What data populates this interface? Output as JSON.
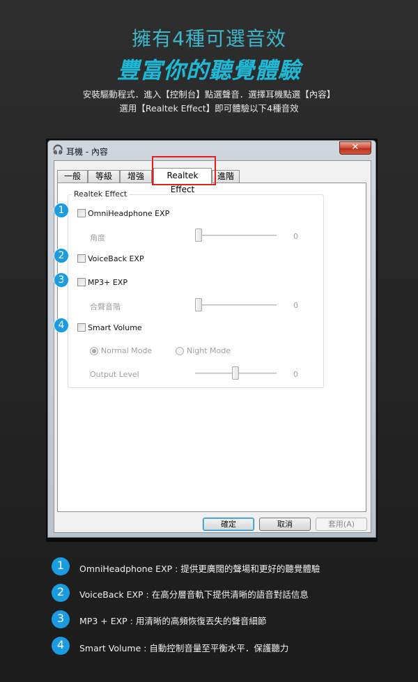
{
  "header": {
    "title_line1": "擁有4種可選音效",
    "title_line2": "豐富你的聽覺體驗",
    "desc_line1": "安裝驅動程式．進入【控制台】點選聲音．選擇耳機點選【內容】",
    "desc_line2": "選用【Realtek Effect】即可體驗以下4種音效"
  },
  "window": {
    "title": "耳機 - 內容",
    "close_label": "✕",
    "tabs": [
      "一般",
      "等級",
      "增強",
      "Realtek Effect",
      "進階"
    ],
    "active_tab": "Realtek Effect",
    "group_label": "Realtek Effect",
    "options": [
      {
        "badge": "1",
        "label": "OmniHeadphone EXP"
      },
      {
        "badge": "2",
        "label": "VoiceBack EXP"
      },
      {
        "badge": "3",
        "label": "MP3+ EXP"
      },
      {
        "badge": "4",
        "label": "Smart Volume"
      }
    ],
    "angle_label": "角度",
    "angle_value": "0",
    "chorus_label": "合聲音階",
    "chorus_value": "0",
    "normal_mode_label": "Normal Mode",
    "night_mode_label": "Night Mode",
    "output_level_label": "Output Level",
    "output_level_value": "0",
    "buttons": {
      "ok": "確定",
      "cancel": "取消",
      "apply": "套用(A)"
    }
  },
  "features": [
    {
      "badge": "1",
      "text": "OmniHeadphone EXP : 提供更廣闊的聲場和更好的聽覺體驗"
    },
    {
      "badge": "2",
      "text": "VoiceBack EXP : 在高分層音軌下提供清晰的語音對話信息"
    },
    {
      "badge": "3",
      "text": "MP3 + EXP : 用清晰的高頻恢復丟失的聲音細節"
    },
    {
      "badge": "4",
      "text": "Smart Volume : 自動控制音量至平衡水平．保護聽力"
    }
  ],
  "colors": {
    "accent": "#1fb9d8",
    "badge": "#1b9be0",
    "highlight": "#e01f1f"
  }
}
